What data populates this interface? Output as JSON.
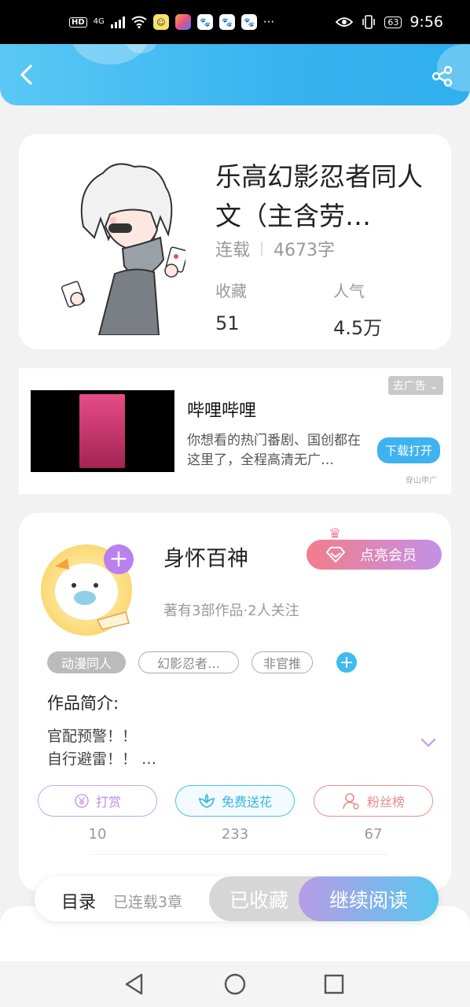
{
  "status_bar": {
    "hd": "HD",
    "network": "4G",
    "more": "···",
    "battery": "63",
    "time": "9:56"
  },
  "book": {
    "title": "乐高幻影忍者同人文（主含劳…",
    "status": "连载",
    "word_count": "4673字",
    "favorites_label": "收藏",
    "favorites_value": "51",
    "popularity_label": "人气",
    "popularity_value": "4.5万"
  },
  "ad": {
    "close_label": "去广告",
    "app_name": "哔哩哔哩",
    "description": "你想看的热门番剧、国创都在这里了，全程高清无广…",
    "download_label": "下载打开",
    "source": "穿山甲广"
  },
  "author": {
    "name": "身怀百神",
    "vip_label": "点亮会员",
    "works_info": "著有3部作品·2人关注",
    "tags": [
      "动漫同人",
      "幻影忍者…",
      "非官推"
    ],
    "intro_title": "作品简介:",
    "intro_line1": "官配预警！！",
    "intro_line2": "自行避雷！！ …"
  },
  "actions": {
    "tip_label": "打赏",
    "tip_count": "10",
    "flower_label": "免费送花",
    "flower_count": "233",
    "fans_label": "粉丝榜",
    "fans_count": "67"
  },
  "bottom_bar": {
    "toc_label": "目录",
    "chapter_count": "已连载3章",
    "collected_label": "已收藏",
    "read_label": "继续阅读"
  },
  "colors": {
    "header_blue": "#38b3ef",
    "vip_pink": "#f37d8a",
    "read_gradient_start": "#b89be6",
    "read_gradient_end": "#57c8ef"
  },
  "icons": [
    "back-icon",
    "share-icon",
    "wifi-icon",
    "eye-icon",
    "vibrate-icon",
    "crown-icon",
    "diamond-icon",
    "yen-icon",
    "flower-icon",
    "user-icon",
    "chevron-down-icon",
    "nav-back-icon",
    "nav-home-icon",
    "nav-recent-icon"
  ]
}
